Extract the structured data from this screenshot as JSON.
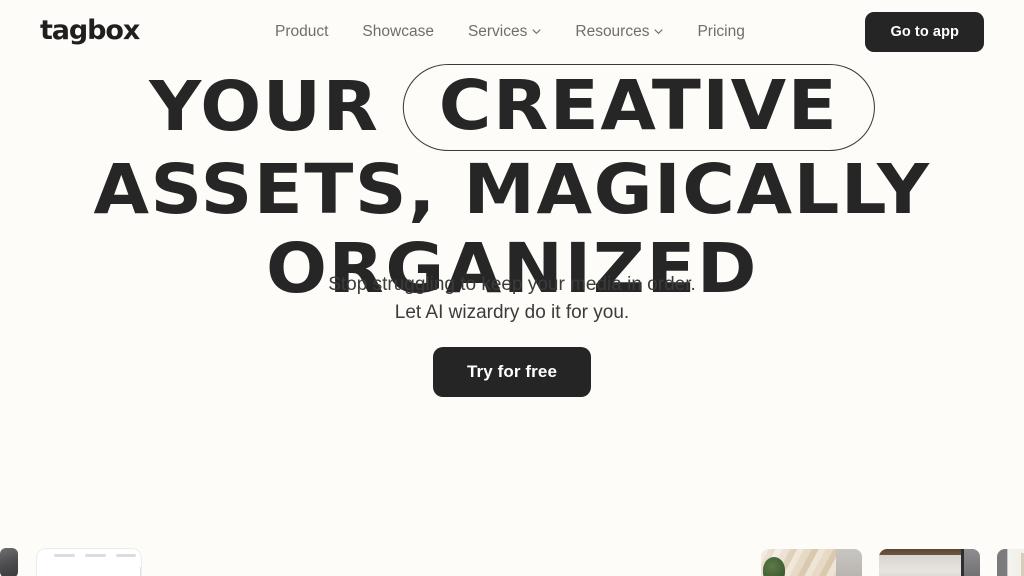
{
  "brand": {
    "logo_text": "tagbox",
    "accent_dark": "#252525",
    "background": "#fdfcf8",
    "nav_text_color": "#6e6e6e",
    "headline_color": "#262626"
  },
  "header": {
    "nav_items": [
      {
        "label": "Product",
        "has_dropdown": false,
        "icon": ""
      },
      {
        "label": "Showcase",
        "has_dropdown": false,
        "icon": ""
      },
      {
        "label": "Services",
        "has_dropdown": true,
        "icon": "chevron-down-icon"
      },
      {
        "label": "Resources",
        "has_dropdown": true,
        "icon": "chevron-down-icon"
      },
      {
        "label": "Pricing",
        "has_dropdown": false,
        "icon": ""
      }
    ],
    "cta_label": "Go to app"
  },
  "hero": {
    "headline": {
      "line1_prefix": "YOUR",
      "line1_pill": "CREATIVE",
      "line2": "ASSETS, MAGICALLY",
      "line3": "ORGANIZED"
    },
    "subtitle_line1": "Stop struggling to keep your media in order.",
    "subtitle_line2": "Let AI wizardry do it for you.",
    "cta_label": "Try for free"
  },
  "bottom_preview": {
    "thumbnails": [
      {
        "name": "wood-plant-photo"
      },
      {
        "name": "interior-room-photo"
      },
      {
        "name": "shelf-photo"
      }
    ]
  }
}
